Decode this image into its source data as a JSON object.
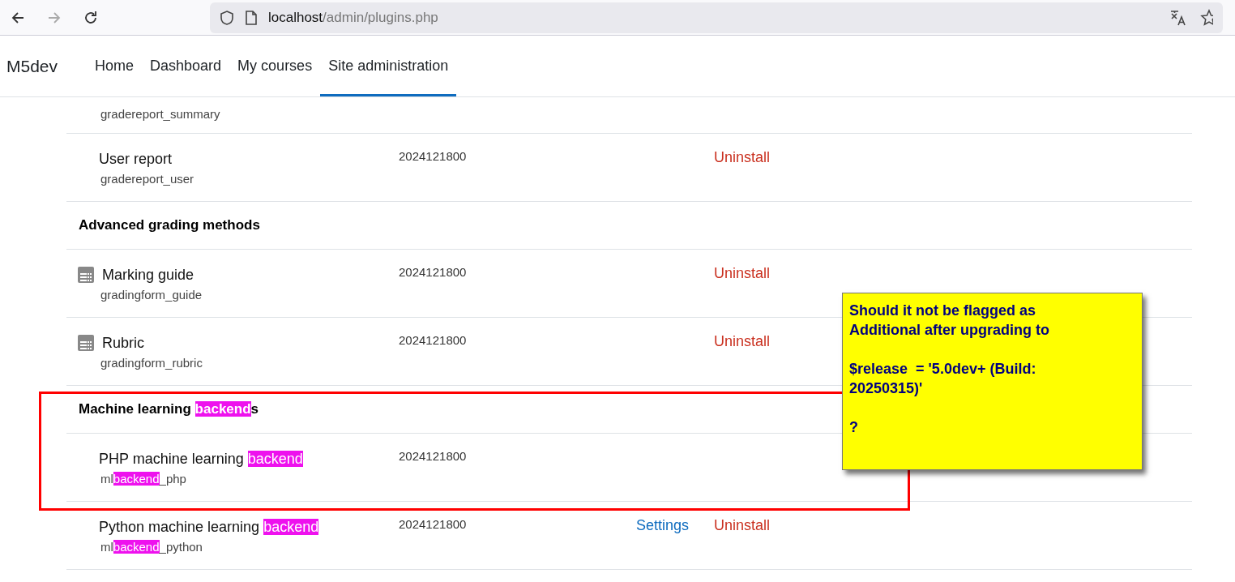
{
  "browser": {
    "url_host": "localhost",
    "url_path": "/admin/plugins.php",
    "forward_disabled": true
  },
  "site": {
    "name": "M5dev"
  },
  "nav": [
    {
      "label": "Home",
      "selected": false
    },
    {
      "label": "Dashboard",
      "selected": false
    },
    {
      "label": "My courses",
      "selected": false
    },
    {
      "label": "Site administration",
      "selected": true
    }
  ],
  "rows": [
    {
      "kind": "partial",
      "component": [
        {
          "text": "gradereport_summary",
          "highlighted": false
        }
      ]
    },
    {
      "kind": "plugin",
      "has_icon": false,
      "name": [
        {
          "text": "User report",
          "highlighted": false
        }
      ],
      "component": [
        {
          "text": "gradereport_user",
          "highlighted": false
        }
      ],
      "version": "2024121800",
      "uninstall": "Uninstall"
    },
    {
      "kind": "section",
      "name": [
        {
          "text": "Advanced grading methods",
          "highlighted": false
        }
      ]
    },
    {
      "kind": "plugin",
      "has_icon": true,
      "name": [
        {
          "text": "Marking guide",
          "highlighted": false
        }
      ],
      "component": [
        {
          "text": "gradingform_guide",
          "highlighted": false
        }
      ],
      "version": "2024121800",
      "uninstall": "Uninstall"
    },
    {
      "kind": "plugin",
      "has_icon": true,
      "name": [
        {
          "text": "Rubric",
          "highlighted": false
        }
      ],
      "component": [
        {
          "text": "gradingform_rubric",
          "highlighted": false
        }
      ],
      "version": "2024121800",
      "uninstall": "Uninstall"
    },
    {
      "kind": "section",
      "name": [
        {
          "text": "Machine learning ",
          "highlighted": false
        },
        {
          "text": "backend",
          "highlighted": true
        },
        {
          "text": "s",
          "highlighted": false
        }
      ]
    },
    {
      "kind": "plugin",
      "has_icon": false,
      "name": [
        {
          "text": "PHP machine learning ",
          "highlighted": false
        },
        {
          "text": "backend",
          "highlighted": true
        }
      ],
      "component": [
        {
          "text": "ml",
          "highlighted": false
        },
        {
          "text": "backend",
          "highlighted": true
        },
        {
          "text": "_php",
          "highlighted": false
        }
      ],
      "version": "2024121800"
    },
    {
      "kind": "plugin",
      "has_icon": false,
      "name": [
        {
          "text": "Python machine learning ",
          "highlighted": false
        },
        {
          "text": "backend",
          "highlighted": true
        }
      ],
      "component": [
        {
          "text": "ml",
          "highlighted": false
        },
        {
          "text": "backend",
          "highlighted": true
        },
        {
          "text": "_python",
          "highlighted": false
        }
      ],
      "version": "2024121800",
      "settings": "Settings",
      "uninstall": "Uninstall"
    }
  ],
  "callout": {
    "lines": [
      "Should it not be flagged as Additional after upgrading to",
      "$release  = '5.0dev+ (Build: 20250315)'",
      "?"
    ]
  }
}
